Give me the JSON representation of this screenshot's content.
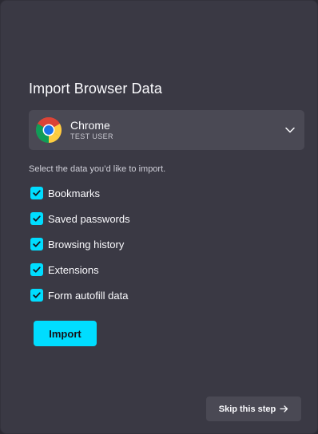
{
  "dialog": {
    "title": "Import Browser Data",
    "browser_select": {
      "name": "Chrome",
      "profile": "TEST USER",
      "icon": "chrome-icon"
    },
    "instruction": "Select the data you’d like to import.",
    "options": [
      {
        "label": "Bookmarks",
        "checked": true
      },
      {
        "label": "Saved passwords",
        "checked": true
      },
      {
        "label": "Browsing history",
        "checked": true
      },
      {
        "label": "Extensions",
        "checked": true
      },
      {
        "label": "Form autofill data",
        "checked": true
      }
    ],
    "import_label": "Import",
    "skip_label": "Skip this step",
    "colors": {
      "background": "#3a3944",
      "accent": "#00ddff",
      "control": "#4a4954",
      "text": "#fbfbfe"
    }
  }
}
